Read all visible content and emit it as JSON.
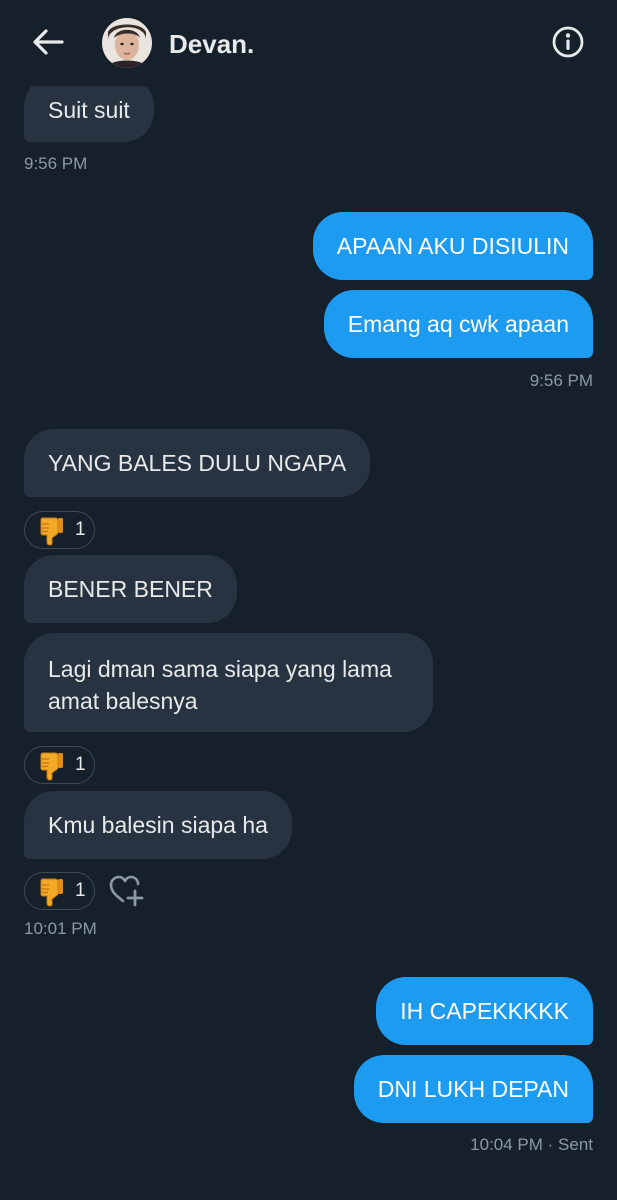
{
  "header": {
    "contact_name": "Devan.",
    "back_icon": "arrow-left-icon",
    "info_icon": "info-circle-icon"
  },
  "colors": {
    "background": "#15202b",
    "incoming_bubble": "#273340",
    "outgoing_bubble": "#1d9bf0",
    "timestamp": "#8b98a5"
  },
  "messages": [
    {
      "direction": "incoming",
      "text": "Suit suit"
    },
    {
      "direction": "incoming",
      "timestamp": "9:56 PM"
    },
    {
      "direction": "outgoing",
      "text": "APAAN AKU DISIULIN"
    },
    {
      "direction": "outgoing",
      "text": "Emang aq cwk apaan"
    },
    {
      "direction": "outgoing",
      "timestamp": "9:56 PM"
    },
    {
      "direction": "incoming",
      "text": "YANG BALES DULU NGAPA",
      "reaction": {
        "emoji": "thumbs-down",
        "count": "1"
      }
    },
    {
      "direction": "incoming",
      "text": "BENER BENER"
    },
    {
      "direction": "incoming",
      "text": "Lagi dman sama siapa yang lama amat balesnya",
      "reaction": {
        "emoji": "thumbs-down",
        "count": "1"
      }
    },
    {
      "direction": "incoming",
      "text": "Kmu balesin siapa ha",
      "reaction": {
        "emoji": "thumbs-down",
        "count": "1"
      }
    },
    {
      "direction": "incoming",
      "timestamp": "10:01 PM"
    },
    {
      "direction": "outgoing",
      "text": "IH CAPEKKKKK"
    },
    {
      "direction": "outgoing",
      "text": "DNI LUKH DEPAN"
    },
    {
      "direction": "outgoing",
      "timestamp": "10:04 PM · Sent"
    }
  ]
}
